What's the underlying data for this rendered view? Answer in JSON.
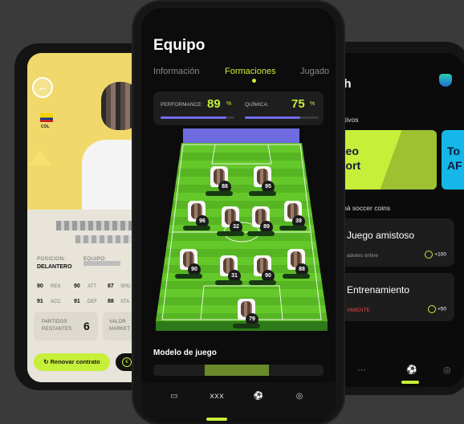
{
  "left": {
    "country": "COL",
    "name_line1": "",
    "name_line2": "",
    "position_label": "POSICIÓN:",
    "position_value": "DELANTERO",
    "team_label": "EQUIPO:",
    "stats": [
      {
        "value": "90",
        "label": "RES"
      },
      {
        "value": "90",
        "label": "ATT"
      },
      {
        "value": "87",
        "label": "SPD"
      },
      {
        "value": "91",
        "label": "ACC"
      },
      {
        "value": "91",
        "label": "DEF"
      },
      {
        "value": "88",
        "label": "STA"
      }
    ],
    "matches_label_1": "PARTIDOS",
    "matches_label_2": "RESTANTES:",
    "matches_value": "6",
    "value_label_1": "VALOR",
    "value_label_2": "MARKET",
    "renew_label": "Renovar contrato",
    "back_icon": "back-arrow-icon"
  },
  "center": {
    "title": "Equipo",
    "tabs": [
      "Información",
      "Formaciones",
      "Jugado"
    ],
    "active_tab": "Formaciones",
    "performance_label": "PERFORMANCE:",
    "performance_value": "89",
    "performance_unit": "%",
    "chemistry_label": "QUÍMICA:",
    "chemistry_value": "75",
    "chemistry_unit": "%",
    "performance_fraction": 0.89,
    "chemistry_fraction": 0.75,
    "players": [
      {
        "rating": "88",
        "plate": ""
      },
      {
        "rating": "95",
        "plate": ""
      },
      {
        "rating": "96",
        "plate": ""
      },
      {
        "rating": "32",
        "plate": ""
      },
      {
        "rating": "89",
        "plate": ""
      },
      {
        "rating": "39",
        "plate": ""
      },
      {
        "rating": "90",
        "plate": ""
      },
      {
        "rating": "31",
        "plate": ""
      },
      {
        "rating": "90",
        "plate": ""
      },
      {
        "rating": "88",
        "plate": ""
      },
      {
        "rating": "79",
        "plate": ""
      }
    ],
    "section_title": "Modelo de juego",
    "nav_icons": [
      "field-icon",
      "formation-icon",
      "ball-icon",
      "coin-icon"
    ],
    "accent": "#c6ef3a"
  },
  "right": {
    "title": "ch",
    "section1": "activos",
    "banner1_line1": "neo",
    "banner1_line2": "port",
    "banner2_line1": "To",
    "banner2_line2": "AF",
    "section2": "umá soccer coins",
    "activities": [
      {
        "title": "Juego amistoso",
        "sub": "adores online",
        "coins": "+100",
        "sub_red": false
      },
      {
        "title": "Entrenamiento",
        "sub": "AMIENTE",
        "coins": "+50",
        "sub_red": true
      }
    ]
  }
}
